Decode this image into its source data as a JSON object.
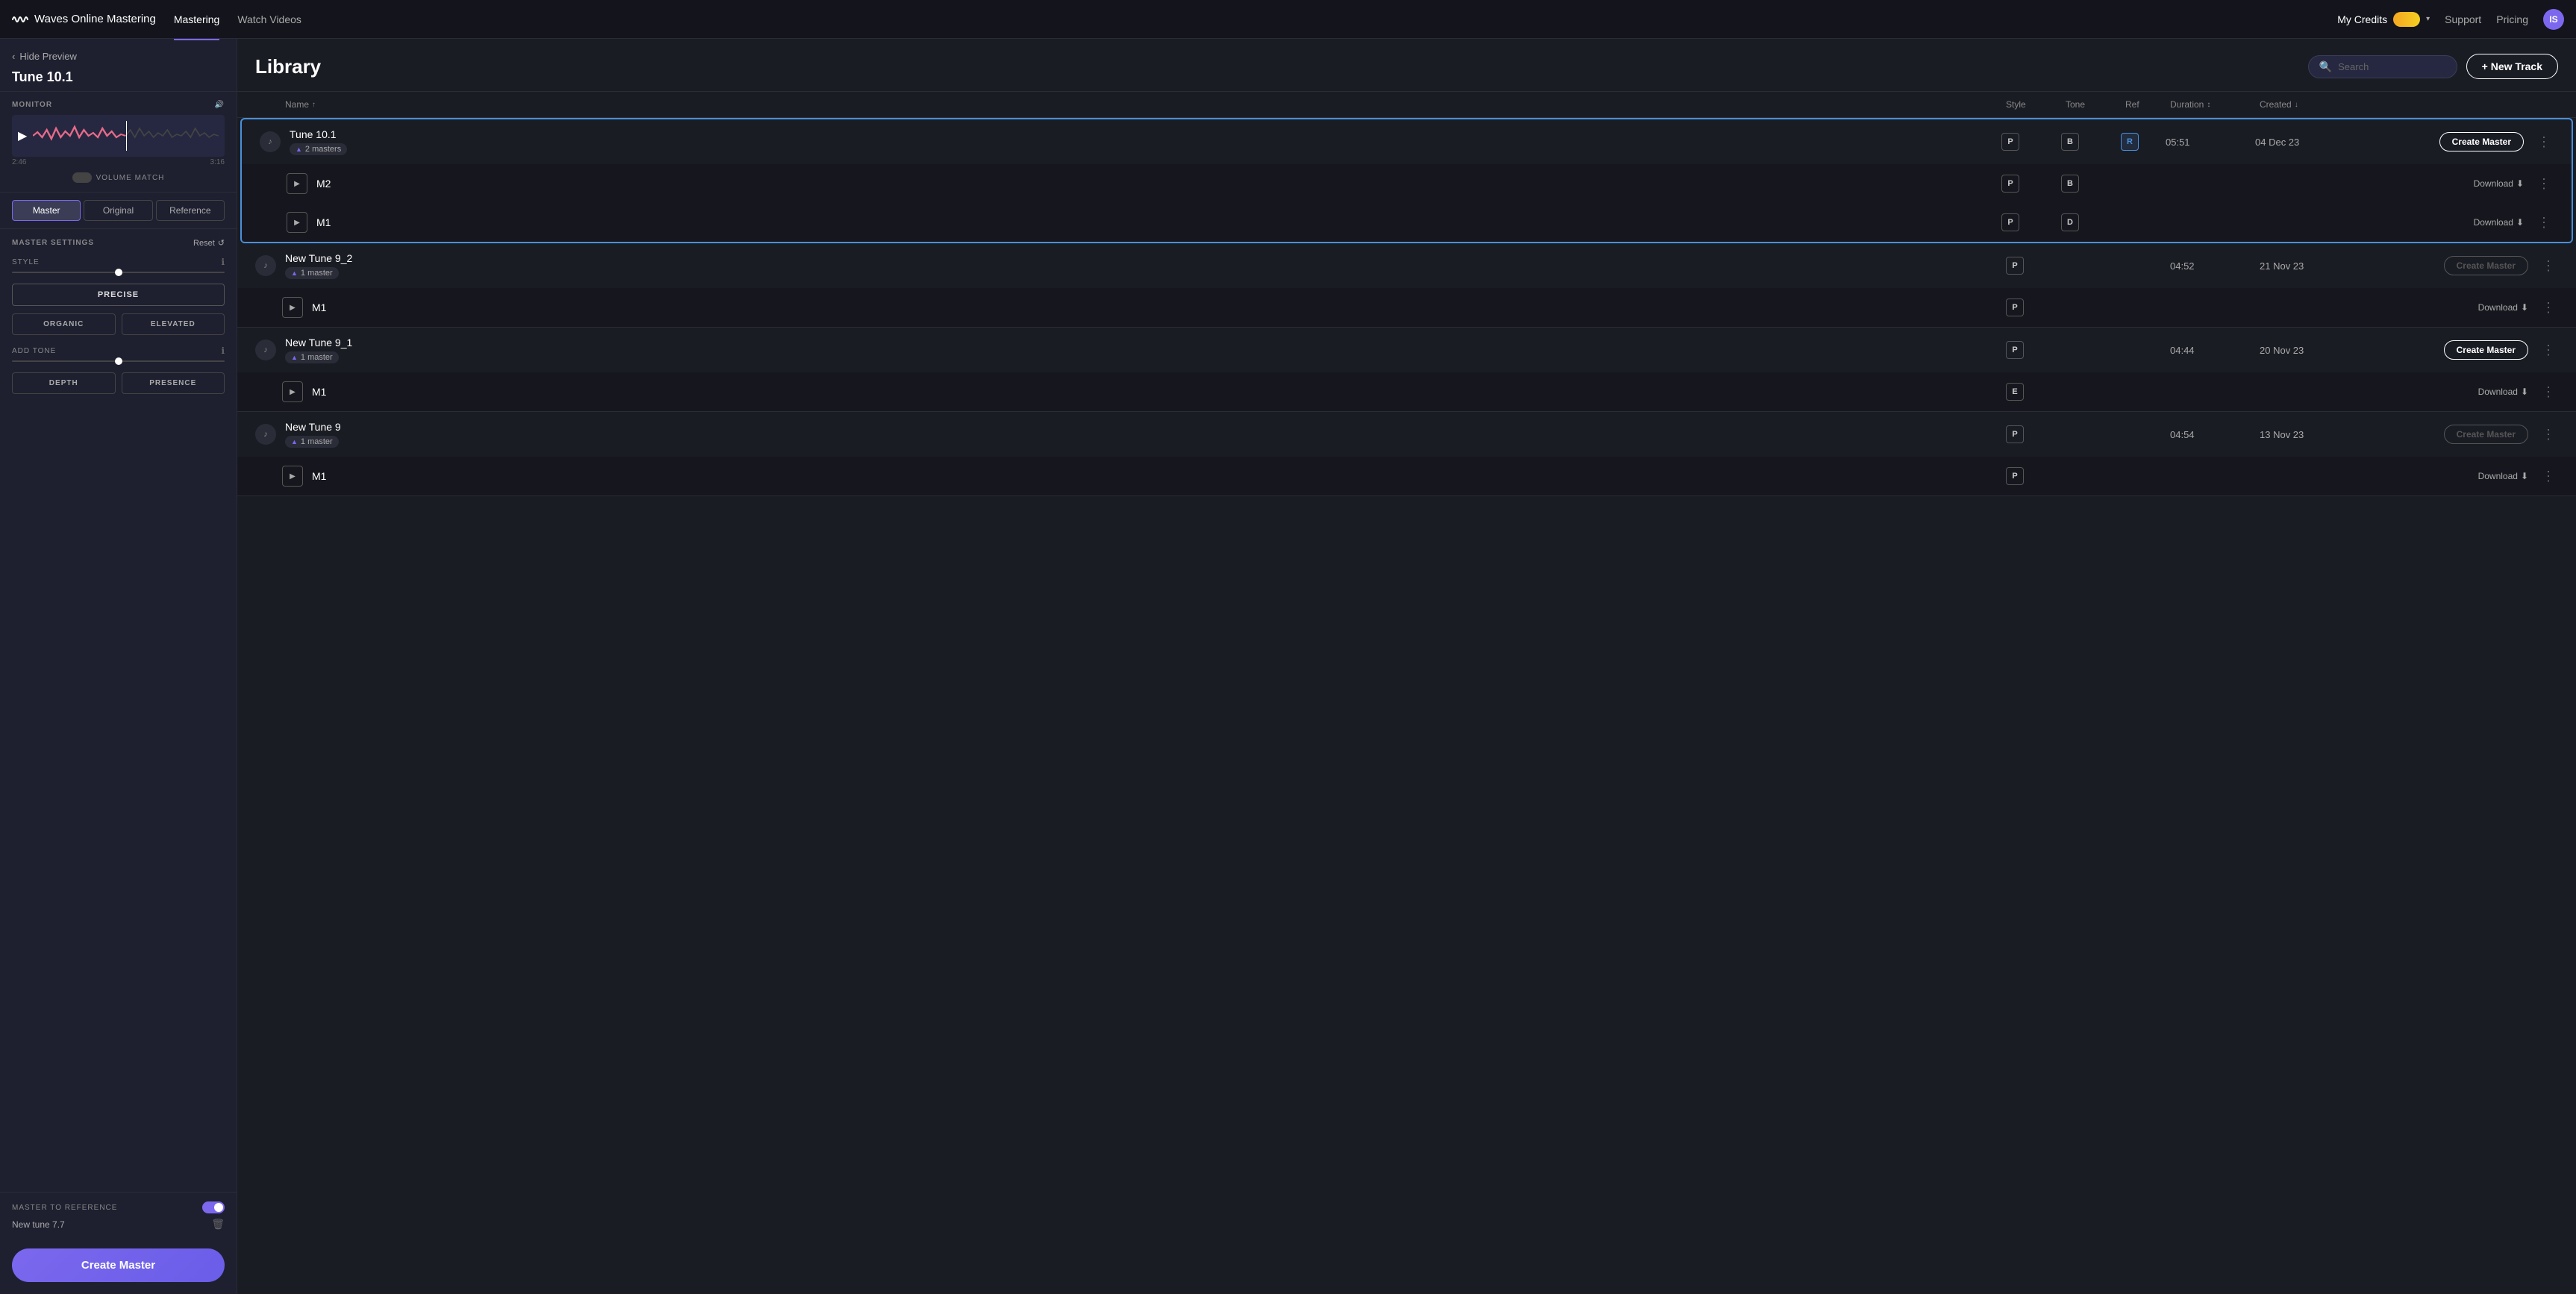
{
  "app": {
    "name": "Waves Online Mastering"
  },
  "nav": {
    "items": [
      {
        "id": "mastering",
        "label": "Mastering",
        "active": true
      },
      {
        "id": "watch-videos",
        "label": "Watch Videos",
        "active": false
      }
    ],
    "right": {
      "my_credits": "My Credits",
      "support": "Support",
      "pricing": "Pricing",
      "avatar_initials": "IS"
    }
  },
  "library": {
    "title": "Library",
    "search_placeholder": "Search",
    "new_track_label": "+ New Track"
  },
  "table": {
    "columns": [
      {
        "id": "icon",
        "label": ""
      },
      {
        "id": "name",
        "label": "Name",
        "sort": "asc",
        "sort_icon": "↑"
      },
      {
        "id": "style",
        "label": "Style"
      },
      {
        "id": "tone",
        "label": "Tone"
      },
      {
        "id": "ref",
        "label": "Ref"
      },
      {
        "id": "duration",
        "label": "Duration",
        "sort_icon": "↕"
      },
      {
        "id": "created",
        "label": "Created",
        "sort": "desc",
        "sort_icon": "↓"
      },
      {
        "id": "actions",
        "label": ""
      },
      {
        "id": "more",
        "label": ""
      }
    ],
    "tracks": [
      {
        "id": "tune10",
        "name": "Tune 10.1",
        "masters_count": 2,
        "masters_label": "2 masters",
        "style_badge": "P",
        "tone_badge": "B",
        "ref_badge": "R",
        "has_ref": true,
        "duration": "05:51",
        "created": "04 Dec 23",
        "selected": true,
        "action": "Create Master",
        "action_disabled": false,
        "children": [
          {
            "id": "tune10-m2",
            "name": "M2",
            "style_badge": "P",
            "tone_badge": "B",
            "tone_label": "B",
            "action": "Download",
            "play": true
          },
          {
            "id": "tune10-m1",
            "name": "M1",
            "style_badge": "P",
            "tone_badge": "D",
            "tone_label": "D",
            "action": "Download",
            "play": true
          }
        ]
      },
      {
        "id": "newtune92",
        "name": "New Tune 9_2",
        "masters_count": 1,
        "masters_label": "1 master",
        "style_badge": "P",
        "tone_badge": "",
        "ref_badge": "",
        "has_ref": false,
        "duration": "04:52",
        "created": "21 Nov 23",
        "selected": false,
        "action": "Create Master",
        "action_disabled": true,
        "children": [
          {
            "id": "newtune92-m1",
            "name": "M1",
            "style_badge": "P",
            "tone_badge": "",
            "action": "Download",
            "play": true
          }
        ]
      },
      {
        "id": "newtune91",
        "name": "New Tune 9_1",
        "masters_count": 1,
        "masters_label": "1 master",
        "style_badge": "P",
        "tone_badge": "",
        "ref_badge": "",
        "has_ref": false,
        "duration": "04:44",
        "created": "20 Nov 23",
        "selected": false,
        "action": "Create Master",
        "action_disabled": false,
        "children": [
          {
            "id": "newtune91-m1",
            "name": "M1",
            "style_badge": "E",
            "tone_badge": "",
            "action": "Download",
            "play": true
          }
        ]
      },
      {
        "id": "newtune9",
        "name": "New Tune 9",
        "masters_count": 1,
        "masters_label": "1 master",
        "style_badge": "P",
        "tone_badge": "",
        "ref_badge": "",
        "has_ref": false,
        "duration": "04:54",
        "created": "13 Nov 23",
        "selected": false,
        "action": "Create Master",
        "action_disabled": true,
        "children": [
          {
            "id": "newtune9-m1",
            "name": "M1",
            "style_badge": "P",
            "tone_badge": "",
            "action": "Download",
            "play": true
          }
        ]
      }
    ]
  },
  "sidebar": {
    "hide_preview": "Hide Preview",
    "track_title": "Tune 10.1",
    "monitor_label": "MONITOR",
    "time_start": "2:46",
    "time_end": "3:16",
    "volume_match": "VOLUME MATCH",
    "tabs": [
      {
        "id": "master",
        "label": "Master",
        "active": true
      },
      {
        "id": "original",
        "label": "Original",
        "active": false
      },
      {
        "id": "reference",
        "label": "Reference",
        "active": false
      }
    ],
    "master_settings_label": "MASTER SETTINGS",
    "reset_label": "Reset",
    "style_label": "STYLE",
    "style_selected": "PRECISE",
    "style_options": [
      "ORGANIC",
      "ELEVATED"
    ],
    "add_tone_label": "ADD TONE",
    "tone_options": [
      "DEPTH",
      "PRESENCE"
    ],
    "master_to_ref_label": "MASTER TO REFERENCE",
    "ref_track": "New tune 7.7",
    "create_master_label": "Create Master"
  }
}
